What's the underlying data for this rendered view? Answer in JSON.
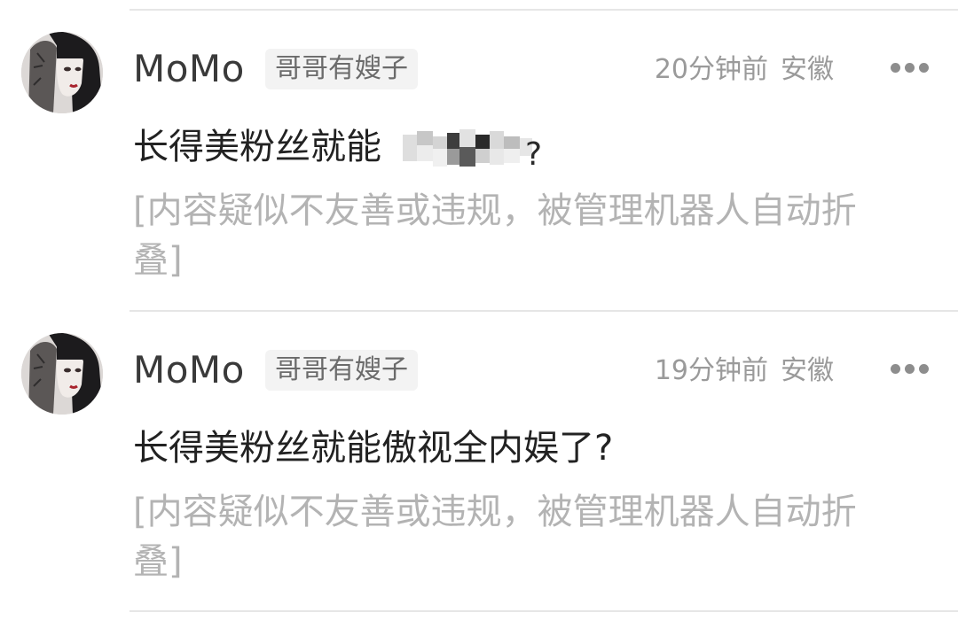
{
  "comments": [
    {
      "username": "MoMo",
      "badge": "哥哥有嫂子",
      "time": "20分钟前",
      "location": "安徽",
      "content_visible": "长得美粉丝就能",
      "folded_notice": "[内容疑似不友善或违规，被管理机器人自动折叠]"
    },
    {
      "username": "MoMo",
      "badge": "哥哥有嫂子",
      "time": "19分钟前",
      "location": "安徽",
      "content": "长得美粉丝就能傲视全内娱了?",
      "folded_notice": "[内容疑似不友善或违规，被管理机器人自动折叠]"
    }
  ],
  "icons": {
    "more": "more-dots-icon",
    "avatar": "avatar-image"
  },
  "colors": {
    "username": "#3a3a3a",
    "meta": "#9a9a9a",
    "folded": "#b3b3b3",
    "badge_bg": "#f3f3f3",
    "divider": "#e6e6e6"
  }
}
